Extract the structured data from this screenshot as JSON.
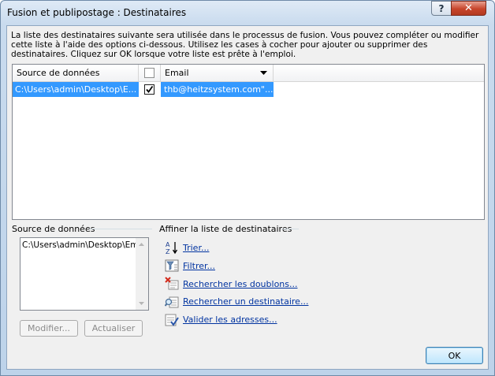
{
  "window": {
    "title": "Fusion et publipostage : Destinataires",
    "help_label": "?",
    "close_label": "✕"
  },
  "intro_text": "La liste des destinataires suivante sera utilisée dans le processus de fusion. Vous pouvez compléter ou modifier cette liste à l'aide des options ci-dessous. Utilisez les cases à cocher pour ajouter ou supprimer des destinataires. Cliquez sur OK lorsque votre liste est prête à l'emploi.",
  "grid": {
    "columns": [
      "Source de données",
      "Email"
    ],
    "rows": [
      {
        "source": "C:\\Users\\admin\\Desktop\\E...",
        "checked": true,
        "email": "thb@heitzsystem.com\"..."
      }
    ]
  },
  "datasource": {
    "label": "Source de données",
    "items": [
      "C:\\Users\\admin\\Desktop\\Email"
    ],
    "modify_label": "Modifier...",
    "refresh_label": "Actualiser"
  },
  "refine": {
    "label": "Affiner la liste de destinataires",
    "links": [
      "Trier...",
      "Filtrer...",
      "Rechercher les doublons...",
      "Rechercher un destinataire...",
      "Valider les adresses..."
    ]
  },
  "ok_label": "OK"
}
